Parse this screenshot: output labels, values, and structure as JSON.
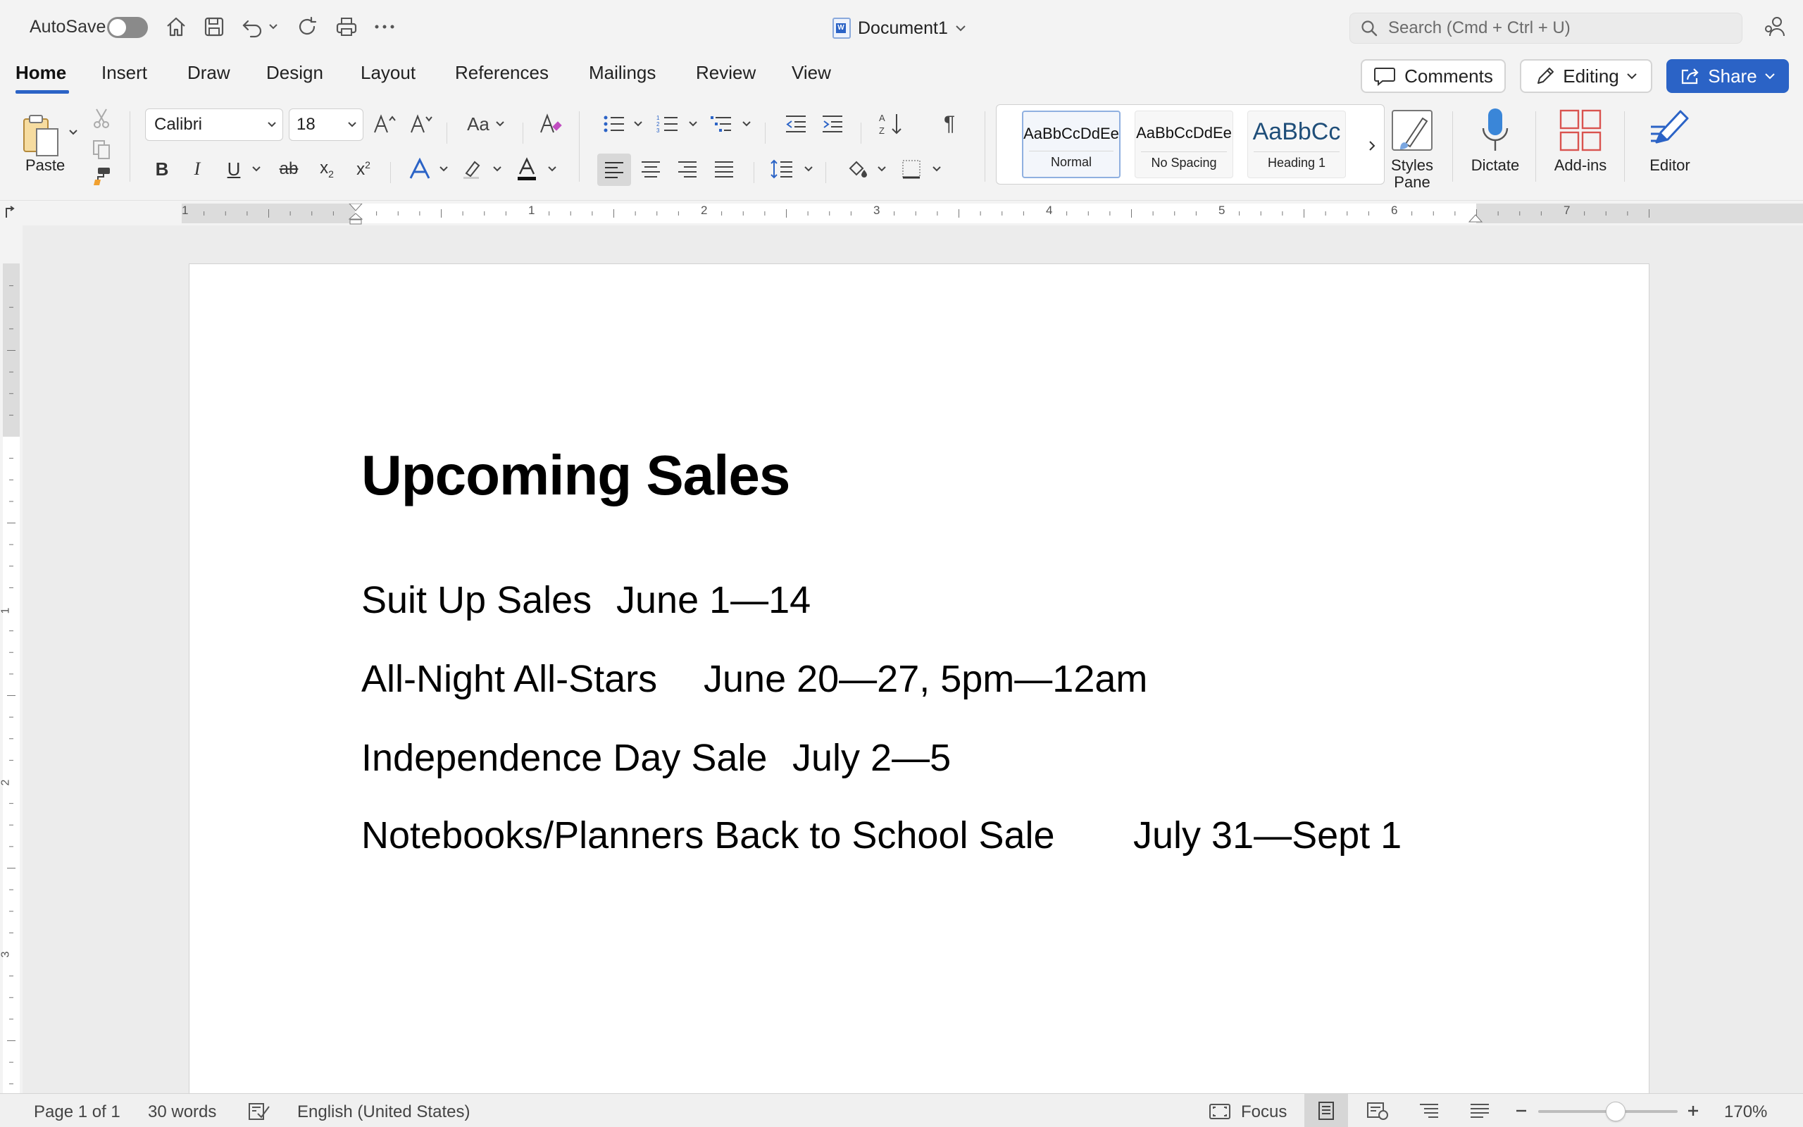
{
  "titlebar": {
    "autosave_label": "AutoSave",
    "document_title": "Document1",
    "search_placeholder": "Search (Cmd + Ctrl + U)"
  },
  "tabs": [
    "Home",
    "Insert",
    "Draw",
    "Design",
    "Layout",
    "References",
    "Mailings",
    "Review",
    "View"
  ],
  "header_buttons": {
    "comments": "Comments",
    "editing": "Editing",
    "share": "Share"
  },
  "ribbon": {
    "paste_label": "Paste",
    "font_name": "Calibri",
    "font_size": "18",
    "change_case_label": "Aa",
    "styles": [
      {
        "sample": "AaBbCcDdEe",
        "name": "Normal"
      },
      {
        "sample": "AaBbCcDdEe",
        "name": "No Spacing"
      },
      {
        "sample": "AaBbCc",
        "name": "Heading 1"
      }
    ],
    "styles_pane_label_1": "Styles",
    "styles_pane_label_2": "Pane",
    "dictate_label": "Dictate",
    "addins_label": "Add-ins",
    "editor_label": "Editor"
  },
  "ruler_numbers": [
    "1",
    "1",
    "2",
    "3",
    "4",
    "5",
    "6",
    "7"
  ],
  "vruler_numbers": [
    "1",
    "2",
    "3"
  ],
  "document": {
    "heading": "Upcoming Sales",
    "lines": [
      {
        "event": "Suit Up Sales",
        "dates": "June 1—14"
      },
      {
        "event": "All-Night All-Stars",
        "dates": "June 20—27, 5pm—12am"
      },
      {
        "event": "Independence Day Sale",
        "dates": "July 2—5"
      },
      {
        "event": "Notebooks/Planners Back to School Sale",
        "dates": "July 31—Sept 1"
      }
    ]
  },
  "statusbar": {
    "page": "Page 1 of 1",
    "words": "30 words",
    "language": "English (United States)",
    "focus": "Focus",
    "zoom": "170%",
    "zoom_level_percent": 170
  },
  "colors": {
    "accent": "#2b63c6",
    "background": "#f3f3f3"
  }
}
